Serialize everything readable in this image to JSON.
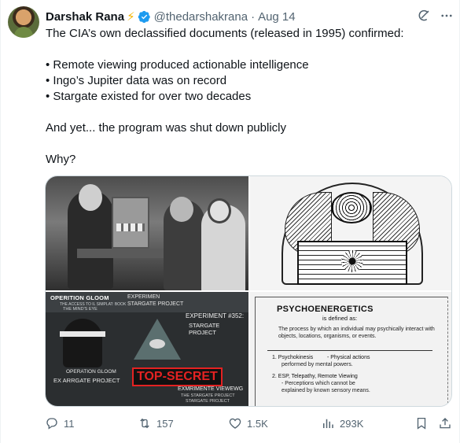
{
  "tweet": {
    "author": {
      "name": "Darshak Rana",
      "emoji": "⚡",
      "handle": "@thedarshakrana",
      "separator": "·",
      "date": "Aug 14"
    },
    "lines": [
      "The CIA’s own declassified documents (released in 1995) confirmed:",
      "",
      "• Remote viewing produced actionable intelligence",
      "• Ingo’s Jupiter data was on record",
      "• Stargate existed for over two decades",
      "",
      "And yet... the program was shut down publicly",
      "",
      "Why?"
    ],
    "media": {
      "collage": {
        "operation_gloom": "OPERITION GLOOM",
        "sub1": "THE ACCESS TO IL SIMPLAT: BOOK",
        "sub2": "THE MIND'S EYE",
        "experiment": "EXPERIMEN",
        "stargate_project": "STARGATE PROJECT",
        "experiment_352": "EXPERIMENT #352:",
        "stargate_project_2": "STARGATE PROJECT",
        "operation_gloom_2": "OPERATION GLOOM",
        "exarrgate": "EX ARRGATE PROJECT",
        "top_secret": "TOP-SECRET",
        "exmriente": "EXMRIMENTE VIEWEWG",
        "the_stargate": "THE STARGATE PROJECT",
        "stargate_project_3": "STARGATE PROJECT"
      },
      "document": {
        "title": "PSYCHOENERGETICS",
        "defined": "is defined as:",
        "body": "The process by which an individual may psychically interact with objects, locations, organisms, or events.",
        "item1_label": "1. Psychokinesis",
        "item1_text": "- Physical actions",
        "item1_text2": "performed by mental powers.",
        "item2_label": "2. ESP, Telepathy, Remote Viewing",
        "item2_text": "- Perceptions which cannot be",
        "item2_text2": "explained by known sensory means."
      }
    },
    "stats": {
      "replies": "11",
      "retweets": "157",
      "likes": "1.5K",
      "views": "293K"
    }
  },
  "colors": {
    "text": "#0f1419",
    "secondary": "#536471",
    "verified": "#1d9bf0",
    "border": "#cfd9de"
  }
}
